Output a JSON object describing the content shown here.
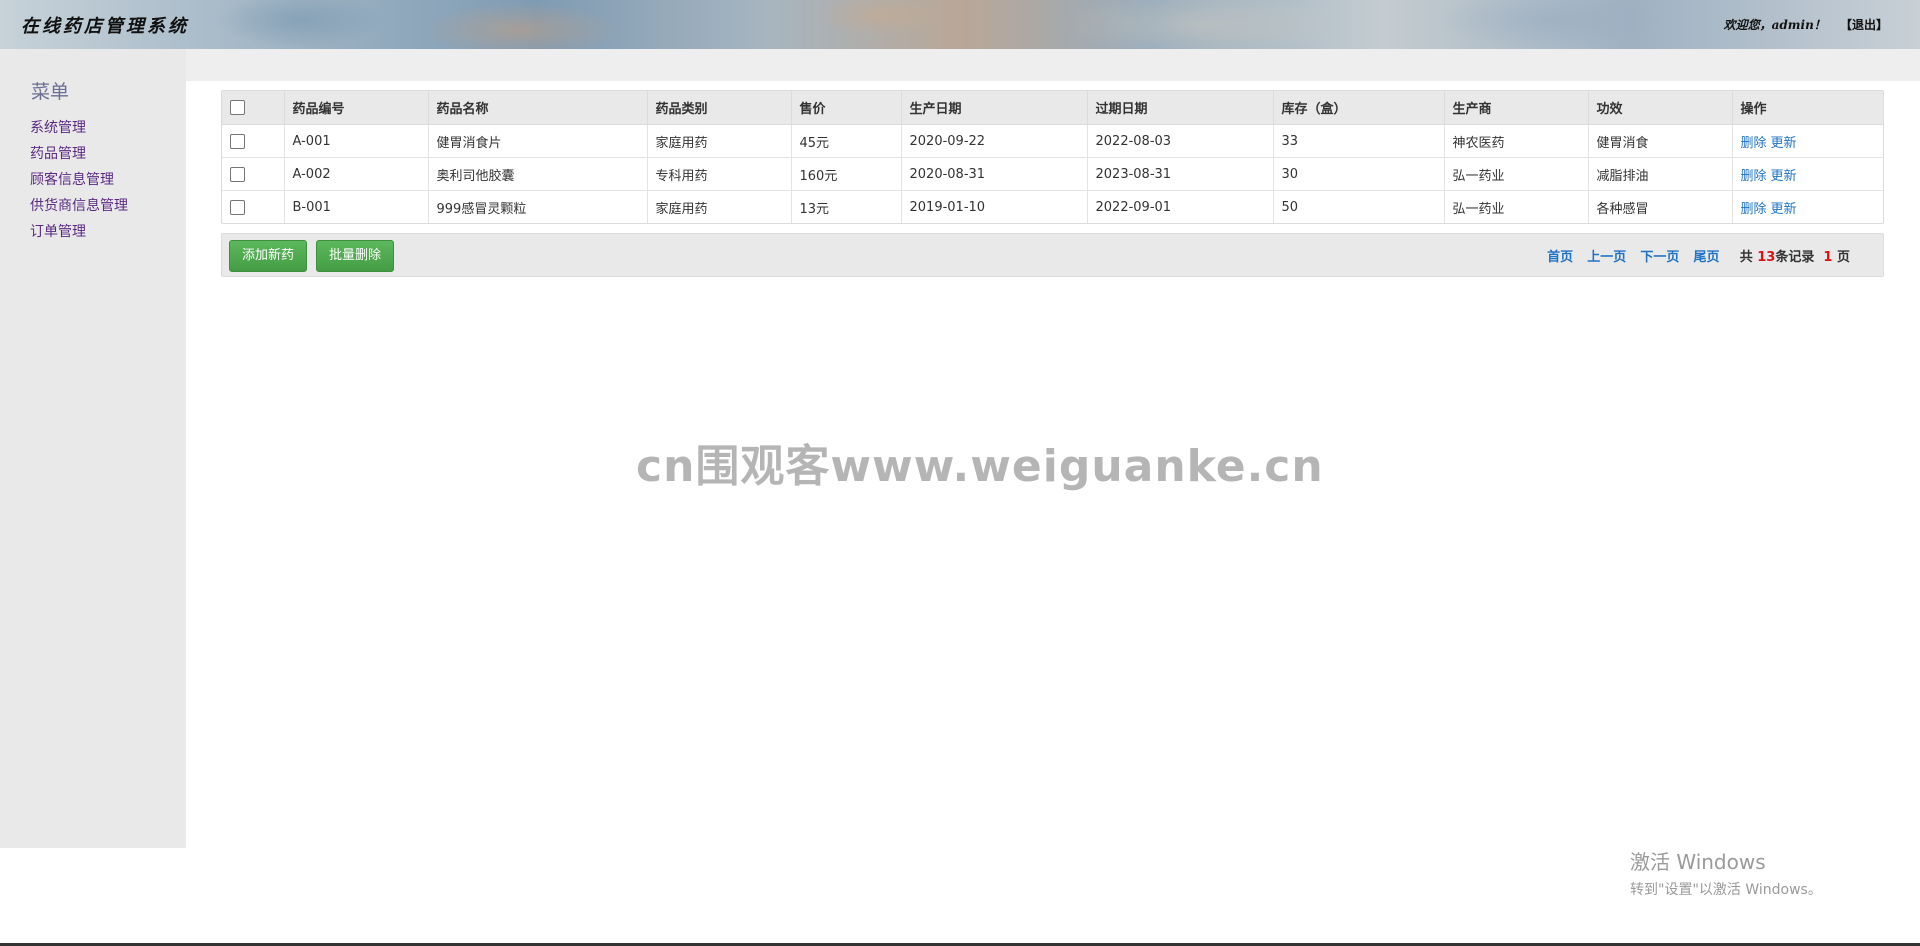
{
  "header": {
    "app_title": "在线药店管理系统",
    "welcome": "欢迎您，admin！",
    "logout": "【退出】"
  },
  "sidebar": {
    "title": "菜单",
    "items": [
      {
        "label": "系统管理"
      },
      {
        "label": "药品管理"
      },
      {
        "label": "顾客信息管理"
      },
      {
        "label": "供货商信息管理"
      },
      {
        "label": "订单管理"
      }
    ]
  },
  "table": {
    "headers": [
      "药品编号",
      "药品名称",
      "药品类别",
      "售价",
      "生产日期",
      "过期日期",
      "库存（盒）",
      "生产商",
      "功效",
      "操作"
    ],
    "rows": [
      {
        "id": "A-001",
        "name": "健胃消食片",
        "category": "家庭用药",
        "price": "45元",
        "mfg_date": "2020-09-22",
        "exp_date": "2022-08-03",
        "stock": "33",
        "maker": "神农医药",
        "effect": "健胃消食"
      },
      {
        "id": "A-002",
        "name": "奥利司他胶囊",
        "category": "专科用药",
        "price": "160元",
        "mfg_date": "2020-08-31",
        "exp_date": "2023-08-31",
        "stock": "30",
        "maker": "弘一药业",
        "effect": "减脂排油"
      },
      {
        "id": "B-001",
        "name": "999感冒灵颗粒",
        "category": "家庭用药",
        "price": "13元",
        "mfg_date": "2019-01-10",
        "exp_date": "2022-09-01",
        "stock": "50",
        "maker": "弘一药业",
        "effect": "各种感冒"
      }
    ],
    "delete_label": "删除",
    "update_label": "更新"
  },
  "toolbar": {
    "add_label": "添加新药",
    "batch_delete_label": "批量删除"
  },
  "pager": {
    "first": "首页",
    "prev": "上一页",
    "next": "下一页",
    "last": "尾页",
    "total_prefix": "共",
    "total_records": "13",
    "records_suffix": "条记录",
    "total_pages": "1",
    "pages_suffix": "页"
  },
  "watermark": "cn围观客www.weiguanke.cn",
  "windows_activation": {
    "line1": "激活 Windows",
    "line2": "转到\"设置\"以激活 Windows。"
  }
}
